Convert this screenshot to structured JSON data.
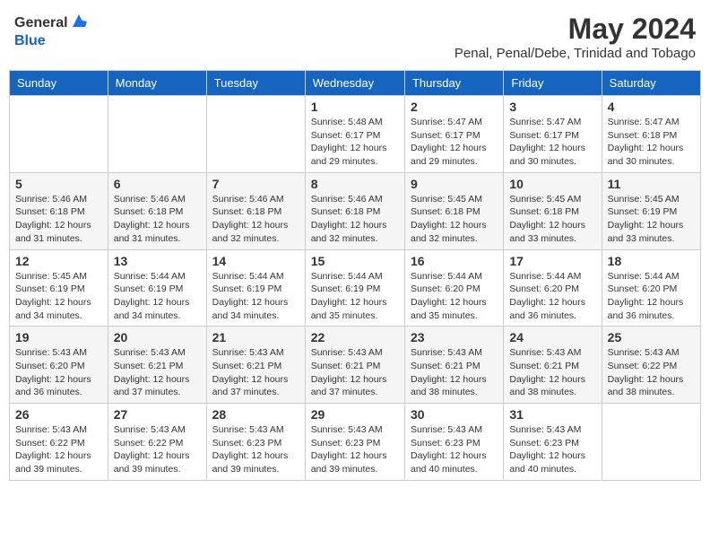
{
  "header": {
    "logo_general": "General",
    "logo_blue": "Blue",
    "main_title": "May 2024",
    "subtitle": "Penal, Penal/Debe, Trinidad and Tobago"
  },
  "days_of_week": [
    "Sunday",
    "Monday",
    "Tuesday",
    "Wednesday",
    "Thursday",
    "Friday",
    "Saturday"
  ],
  "weeks": [
    [
      {
        "day": "",
        "info": ""
      },
      {
        "day": "",
        "info": ""
      },
      {
        "day": "",
        "info": ""
      },
      {
        "day": "1",
        "info": "Sunrise: 5:48 AM\nSunset: 6:17 PM\nDaylight: 12 hours and 29 minutes."
      },
      {
        "day": "2",
        "info": "Sunrise: 5:47 AM\nSunset: 6:17 PM\nDaylight: 12 hours and 29 minutes."
      },
      {
        "day": "3",
        "info": "Sunrise: 5:47 AM\nSunset: 6:17 PM\nDaylight: 12 hours and 30 minutes."
      },
      {
        "day": "4",
        "info": "Sunrise: 5:47 AM\nSunset: 6:18 PM\nDaylight: 12 hours and 30 minutes."
      }
    ],
    [
      {
        "day": "5",
        "info": "Sunrise: 5:46 AM\nSunset: 6:18 PM\nDaylight: 12 hours and 31 minutes."
      },
      {
        "day": "6",
        "info": "Sunrise: 5:46 AM\nSunset: 6:18 PM\nDaylight: 12 hours and 31 minutes."
      },
      {
        "day": "7",
        "info": "Sunrise: 5:46 AM\nSunset: 6:18 PM\nDaylight: 12 hours and 32 minutes."
      },
      {
        "day": "8",
        "info": "Sunrise: 5:46 AM\nSunset: 6:18 PM\nDaylight: 12 hours and 32 minutes."
      },
      {
        "day": "9",
        "info": "Sunrise: 5:45 AM\nSunset: 6:18 PM\nDaylight: 12 hours and 32 minutes."
      },
      {
        "day": "10",
        "info": "Sunrise: 5:45 AM\nSunset: 6:18 PM\nDaylight: 12 hours and 33 minutes."
      },
      {
        "day": "11",
        "info": "Sunrise: 5:45 AM\nSunset: 6:19 PM\nDaylight: 12 hours and 33 minutes."
      }
    ],
    [
      {
        "day": "12",
        "info": "Sunrise: 5:45 AM\nSunset: 6:19 PM\nDaylight: 12 hours and 34 minutes."
      },
      {
        "day": "13",
        "info": "Sunrise: 5:44 AM\nSunset: 6:19 PM\nDaylight: 12 hours and 34 minutes."
      },
      {
        "day": "14",
        "info": "Sunrise: 5:44 AM\nSunset: 6:19 PM\nDaylight: 12 hours and 34 minutes."
      },
      {
        "day": "15",
        "info": "Sunrise: 5:44 AM\nSunset: 6:19 PM\nDaylight: 12 hours and 35 minutes."
      },
      {
        "day": "16",
        "info": "Sunrise: 5:44 AM\nSunset: 6:20 PM\nDaylight: 12 hours and 35 minutes."
      },
      {
        "day": "17",
        "info": "Sunrise: 5:44 AM\nSunset: 6:20 PM\nDaylight: 12 hours and 36 minutes."
      },
      {
        "day": "18",
        "info": "Sunrise: 5:44 AM\nSunset: 6:20 PM\nDaylight: 12 hours and 36 minutes."
      }
    ],
    [
      {
        "day": "19",
        "info": "Sunrise: 5:43 AM\nSunset: 6:20 PM\nDaylight: 12 hours and 36 minutes."
      },
      {
        "day": "20",
        "info": "Sunrise: 5:43 AM\nSunset: 6:21 PM\nDaylight: 12 hours and 37 minutes."
      },
      {
        "day": "21",
        "info": "Sunrise: 5:43 AM\nSunset: 6:21 PM\nDaylight: 12 hours and 37 minutes."
      },
      {
        "day": "22",
        "info": "Sunrise: 5:43 AM\nSunset: 6:21 PM\nDaylight: 12 hours and 37 minutes."
      },
      {
        "day": "23",
        "info": "Sunrise: 5:43 AM\nSunset: 6:21 PM\nDaylight: 12 hours and 38 minutes."
      },
      {
        "day": "24",
        "info": "Sunrise: 5:43 AM\nSunset: 6:21 PM\nDaylight: 12 hours and 38 minutes."
      },
      {
        "day": "25",
        "info": "Sunrise: 5:43 AM\nSunset: 6:22 PM\nDaylight: 12 hours and 38 minutes."
      }
    ],
    [
      {
        "day": "26",
        "info": "Sunrise: 5:43 AM\nSunset: 6:22 PM\nDaylight: 12 hours and 39 minutes."
      },
      {
        "day": "27",
        "info": "Sunrise: 5:43 AM\nSunset: 6:22 PM\nDaylight: 12 hours and 39 minutes."
      },
      {
        "day": "28",
        "info": "Sunrise: 5:43 AM\nSunset: 6:23 PM\nDaylight: 12 hours and 39 minutes."
      },
      {
        "day": "29",
        "info": "Sunrise: 5:43 AM\nSunset: 6:23 PM\nDaylight: 12 hours and 39 minutes."
      },
      {
        "day": "30",
        "info": "Sunrise: 5:43 AM\nSunset: 6:23 PM\nDaylight: 12 hours and 40 minutes."
      },
      {
        "day": "31",
        "info": "Sunrise: 5:43 AM\nSunset: 6:23 PM\nDaylight: 12 hours and 40 minutes."
      },
      {
        "day": "",
        "info": ""
      }
    ]
  ]
}
